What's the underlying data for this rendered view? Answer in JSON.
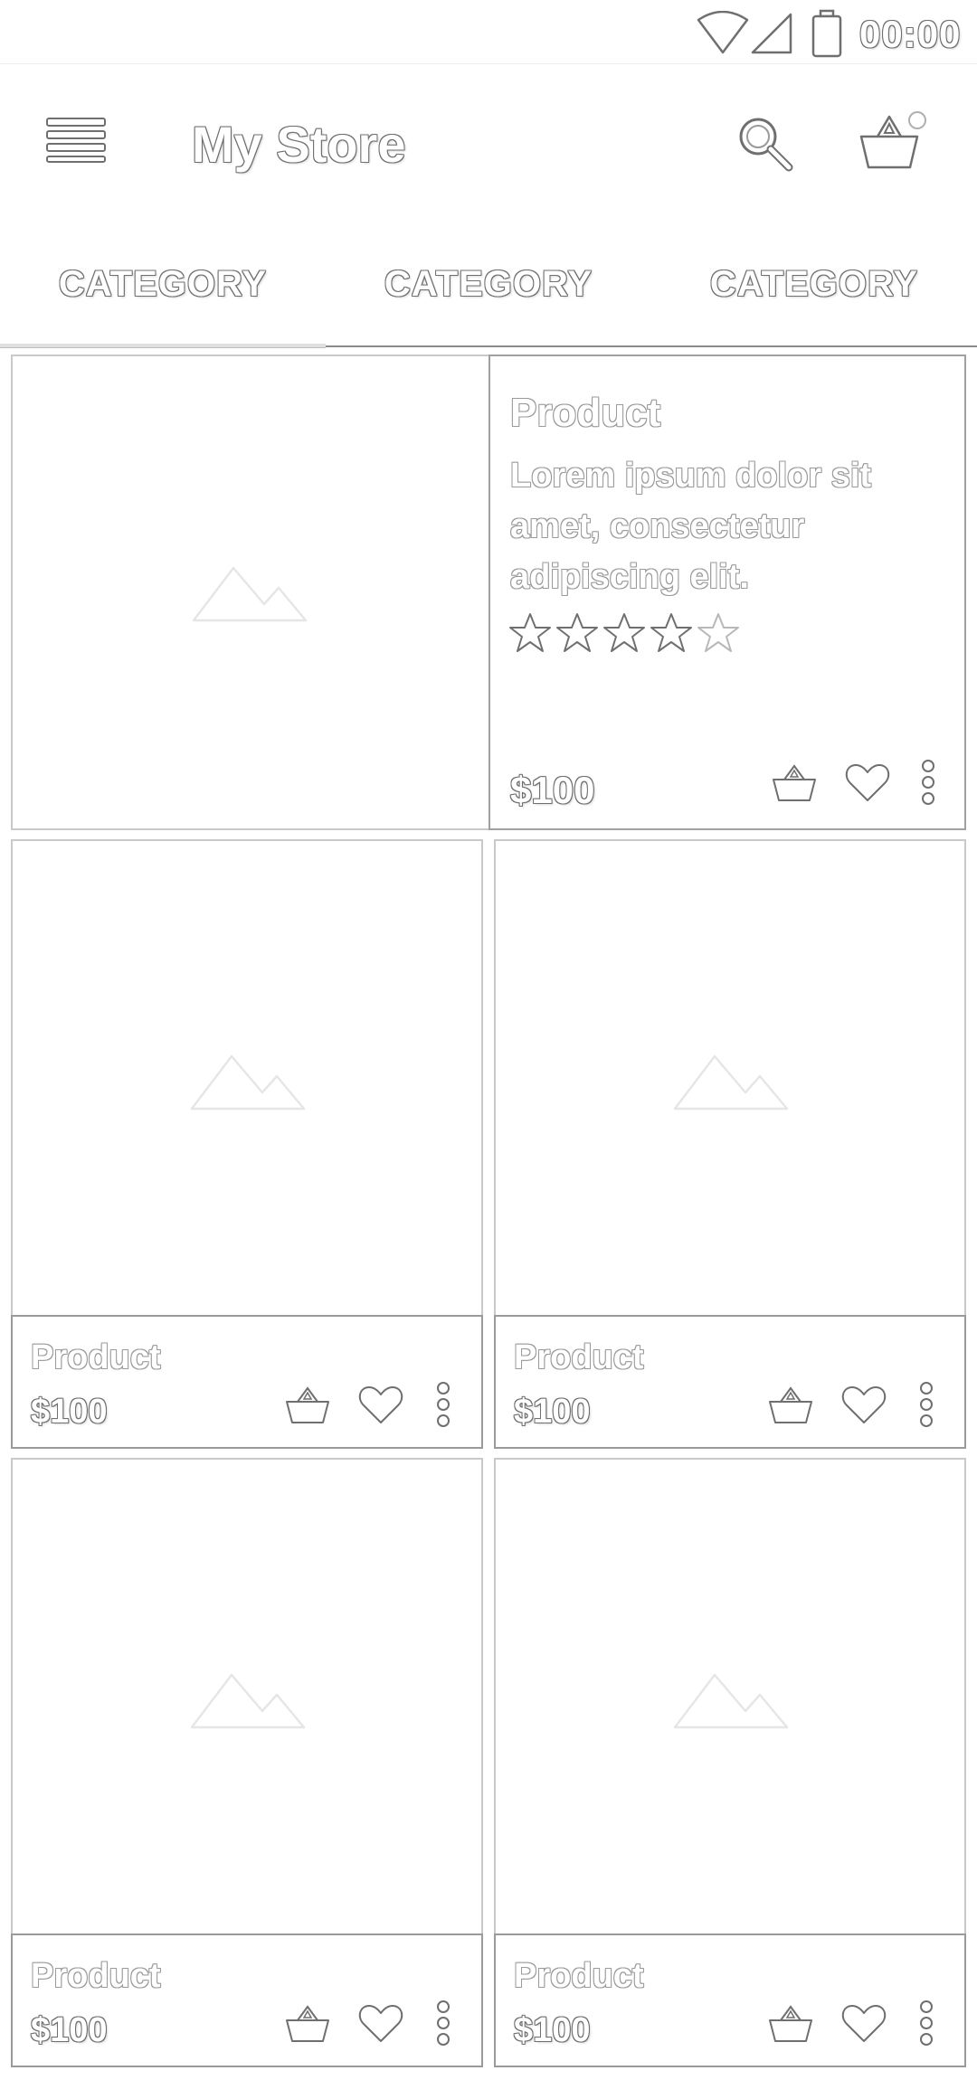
{
  "status_bar": {
    "time": "00:00"
  },
  "app_bar": {
    "title": "My Store"
  },
  "tabs": [
    {
      "label": "CATEGORY"
    },
    {
      "label": "CATEGORY"
    },
    {
      "label": "CATEGORY"
    }
  ],
  "featured": {
    "name": "Product",
    "description_lines": [
      "Lorem ipsum dolor sit",
      "amet, consectetur",
      "adipiscing elit."
    ],
    "rating": 4,
    "rating_max": 5,
    "price": "$100"
  },
  "products": [
    {
      "name": "Product",
      "price": "$100"
    },
    {
      "name": "Product",
      "price": "$100"
    },
    {
      "name": "Product",
      "price": "$100"
    },
    {
      "name": "Product",
      "price": "$100"
    }
  ],
  "icons": [
    "menu-icon",
    "search-icon",
    "cart-icon",
    "basket-icon",
    "heart-icon",
    "more-vert-icon",
    "star-icon",
    "image-placeholder-icon",
    "wifi-icon",
    "cell-signal-icon",
    "battery-icon"
  ]
}
